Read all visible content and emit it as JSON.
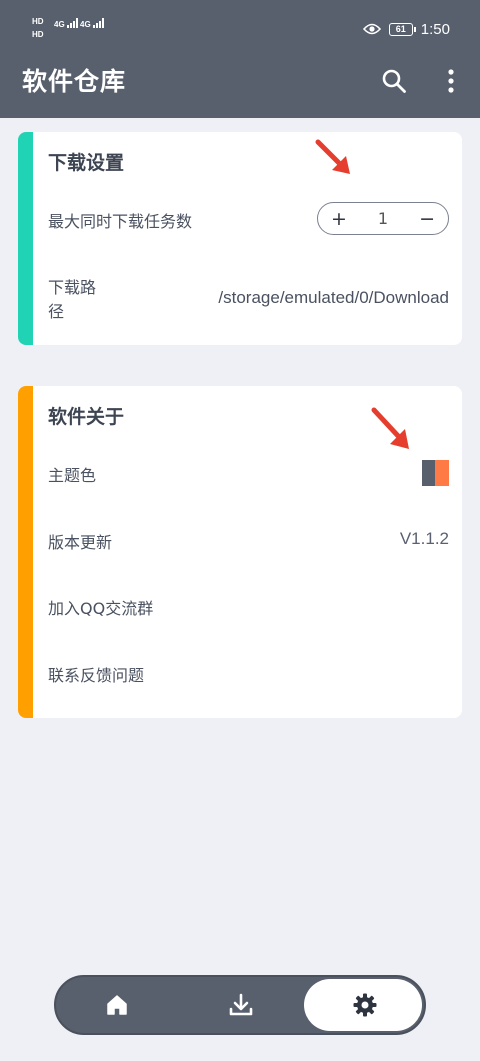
{
  "status_bar": {
    "hd1": "HD",
    "hd2": "HD",
    "net1": "4G",
    "net2": "4G",
    "battery": "61",
    "time": "1:50"
  },
  "app_bar": {
    "title": "软件仓库",
    "search_icon": "search-icon",
    "more_icon": "more-vert-icon",
    "background": "#585f6d"
  },
  "download_settings": {
    "title": "下载设置",
    "accent": "#1fd3b4",
    "max_tasks_label": "最大同时下载任务数",
    "stepper": {
      "plus": "+",
      "value": "1",
      "minus": "−"
    },
    "path_label_line1": "下载路",
    "path_label_line2": "径",
    "path_value": "/storage/emulated/0/Download"
  },
  "about": {
    "title": "软件关于",
    "accent": "#ffa000",
    "theme_color_label": "主题色",
    "theme_colors": [
      "#585f6d",
      "#ff7a45"
    ],
    "version_label": "版本更新",
    "version_value": "V1.1.2",
    "qq_group_label": "加入QQ交流群",
    "feedback_label": "联系反馈问题"
  },
  "bottom_nav": {
    "items": [
      "home-icon",
      "download-icon",
      "settings-icon"
    ],
    "active": "settings-icon"
  },
  "annotation_color": "#e53e2f"
}
